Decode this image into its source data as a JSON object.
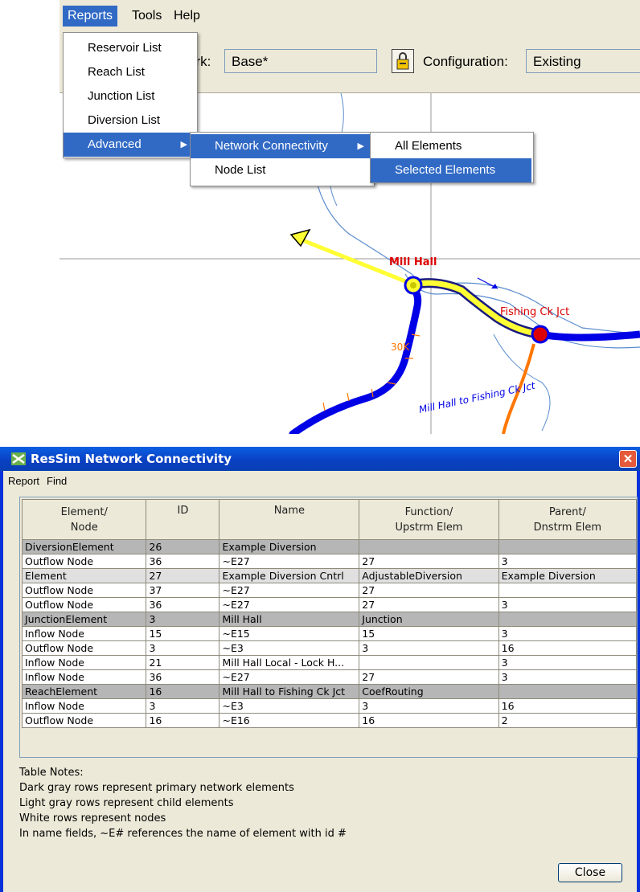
{
  "app_menu": {
    "reports": "Reports",
    "tools": "Tools",
    "help": "Help"
  },
  "toolbar": {
    "network_label": "ork:",
    "network_value": "Base*",
    "configuration_label": "Configuration:",
    "configuration_value": "Existing"
  },
  "reports_menu": {
    "items": [
      "Reservoir List",
      "Reach List",
      "Junction List",
      "Diversion List",
      "Advanced"
    ]
  },
  "advanced_menu": {
    "items": [
      "Network Connectivity",
      "Node List"
    ]
  },
  "connectivity_menu": {
    "items": [
      "All Elements",
      "Selected Elements"
    ]
  },
  "map": {
    "labels": {
      "mill_hall": "Mill Hall",
      "fishing_ck_jct": "Fishing Ck Jct",
      "reach_label": "Mill Hall to Fishing Ck Jct",
      "marker_30k": "30K"
    },
    "colors": {
      "river": "#0000e6",
      "reach_selected": "#ffff33",
      "junction": "#dd0000",
      "tributary": "#ff7700",
      "stream_outline": "#5a8ccf"
    }
  },
  "dialog": {
    "title": "ResSim Network Connectivity",
    "menu": [
      "Report",
      "Find"
    ],
    "columns": [
      "Element/\nNode",
      "ID",
      "Name",
      "Function/\nUpstrm Elem",
      "Parent/\nDnstrm Elem"
    ],
    "rows": [
      {
        "type": "primary",
        "cells": [
          "DiversionElement",
          "26",
          "Example Diversion",
          "",
          ""
        ]
      },
      {
        "type": "node",
        "cells": [
          "Outflow Node",
          "36",
          "~E27",
          "27",
          "3"
        ]
      },
      {
        "type": "child",
        "cells": [
          "Element",
          "27",
          "Example Diversion Cntrl",
          "AdjustableDiversion",
          "Example Diversion"
        ]
      },
      {
        "type": "node",
        "cells": [
          "Outflow Node",
          "37",
          "~E27",
          "27",
          ""
        ]
      },
      {
        "type": "node",
        "cells": [
          "Outflow Node",
          "36",
          "~E27",
          "27",
          "3"
        ]
      },
      {
        "type": "primary",
        "cells": [
          "JunctionElement",
          "3",
          "Mill Hall",
          "Junction",
          ""
        ]
      },
      {
        "type": "node",
        "cells": [
          "Inflow Node",
          "15",
          "~E15",
          "15",
          "3"
        ]
      },
      {
        "type": "node",
        "cells": [
          "Outflow Node",
          "3",
          "~E3",
          "3",
          "16"
        ]
      },
      {
        "type": "node",
        "cells": [
          "Inflow Node",
          "21",
          "Mill Hall Local - Lock H...",
          "",
          "3"
        ]
      },
      {
        "type": "node",
        "cells": [
          "Inflow Node",
          "36",
          "~E27",
          "27",
          "3"
        ]
      },
      {
        "type": "primary",
        "cells": [
          "ReachElement",
          "16",
          "Mill Hall to Fishing Ck Jct",
          "CoefRouting",
          ""
        ]
      },
      {
        "type": "node",
        "cells": [
          "Inflow Node",
          "3",
          "~E3",
          "3",
          "16"
        ]
      },
      {
        "type": "node",
        "cells": [
          "Outflow Node",
          "16",
          "~E16",
          "16",
          "2"
        ]
      }
    ],
    "notes": [
      "Table Notes:",
      "Dark gray rows represent primary network elements",
      "Light gray rows represent child elements",
      "White rows represent nodes",
      "In name fields, ~E# references the name of element with id #"
    ],
    "close_label": "Close"
  }
}
